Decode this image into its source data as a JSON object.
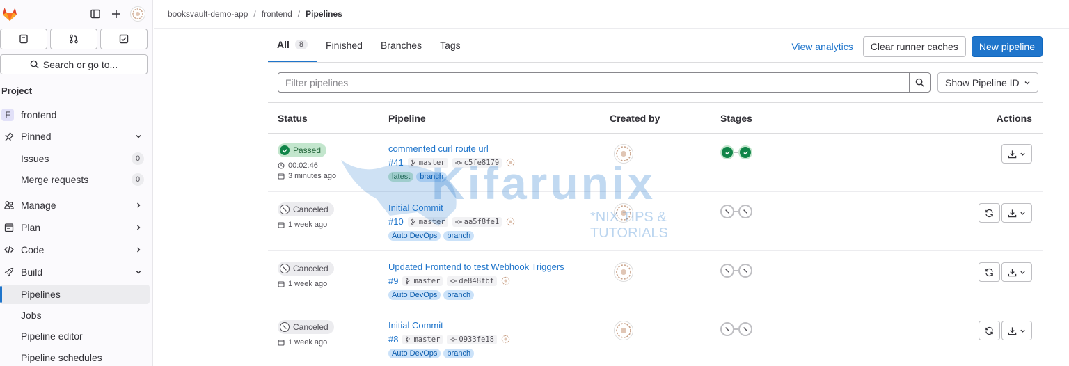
{
  "sidebar": {
    "search_label": "Search or go to...",
    "section_title": "Project",
    "project_initial": "F",
    "project_name": "frontend",
    "items": [
      {
        "label": "Pinned"
      },
      {
        "label": "Issues",
        "count": "0"
      },
      {
        "label": "Merge requests",
        "count": "0"
      },
      {
        "label": "Manage"
      },
      {
        "label": "Plan"
      },
      {
        "label": "Code"
      },
      {
        "label": "Build"
      },
      {
        "label": "Pipelines"
      },
      {
        "label": "Jobs"
      },
      {
        "label": "Pipeline editor"
      },
      {
        "label": "Pipeline schedules"
      }
    ]
  },
  "breadcrumb": [
    "booksvault-demo-app",
    "frontend",
    "Pipelines"
  ],
  "tabs": [
    {
      "label": "All",
      "count": "8"
    },
    {
      "label": "Finished"
    },
    {
      "label": "Branches"
    },
    {
      "label": "Tags"
    }
  ],
  "toolbar": {
    "analytics": "View analytics",
    "clear_caches": "Clear runner caches",
    "new_pipeline": "New pipeline"
  },
  "filter": {
    "placeholder": "Filter pipelines",
    "show_id": "Show Pipeline ID"
  },
  "table": {
    "headers": [
      "Status",
      "Pipeline",
      "Created by",
      "Stages",
      "Actions"
    ],
    "rows": [
      {
        "status": "Passed",
        "duration": "00:02:46",
        "time": "3 minutes ago",
        "title": "commented curl route url",
        "id": "#41",
        "branch": "master",
        "sha": "c5fe8179",
        "tags": [
          "latest",
          "branch"
        ]
      },
      {
        "status": "Canceled",
        "time": "1 week ago",
        "title": "Initial Commit",
        "id": "#10",
        "branch": "master",
        "sha": "aa5f8fe1",
        "tags": [
          "Auto DevOps",
          "branch"
        ]
      },
      {
        "status": "Canceled",
        "time": "1 week ago",
        "title": "Updated Frontend to test Webhook Triggers",
        "id": "#9",
        "branch": "master",
        "sha": "de848fbf",
        "tags": [
          "Auto DevOps",
          "branch"
        ]
      },
      {
        "status": "Canceled",
        "time": "1 week ago",
        "title": "Initial Commit",
        "id": "#8",
        "branch": "master",
        "sha": "0933fe18",
        "tags": [
          "Auto DevOps",
          "branch"
        ]
      }
    ]
  },
  "watermark": {
    "title": "Kifarunix",
    "subtitle": "*NIX TIPS & TUTORIALS"
  },
  "colors": {
    "accent": "#1f75cb",
    "success": "#108548",
    "brand": "#e24329"
  }
}
